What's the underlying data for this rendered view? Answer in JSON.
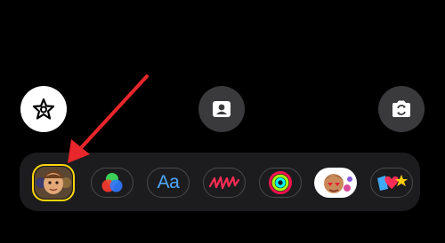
{
  "top_controls": {
    "effects_icon": "star-effects-icon",
    "contact_icon": "contact-card-icon",
    "flip_icon": "camera-flip-icon"
  },
  "effects_tray": {
    "items": [
      {
        "name": "memoji-stickers",
        "icon": "memoji-avatar-icon"
      },
      {
        "name": "filters",
        "icon": "color-filters-icon"
      },
      {
        "name": "text",
        "label": "Aa"
      },
      {
        "name": "shapes",
        "icon": "scribble-icon"
      },
      {
        "name": "activity",
        "icon": "activity-rings-icon"
      },
      {
        "name": "memoji",
        "icon": "memoji-sticker-icon"
      },
      {
        "name": "emoji-stickers",
        "icon": "emoji-stickers-icon"
      }
    ]
  },
  "colors": {
    "background": "#000000",
    "tray": "#1c1c1e",
    "selected_ring": "#ffd60a",
    "annotation_arrow": "#e8262b",
    "text_effect": "#4fa8ff"
  }
}
